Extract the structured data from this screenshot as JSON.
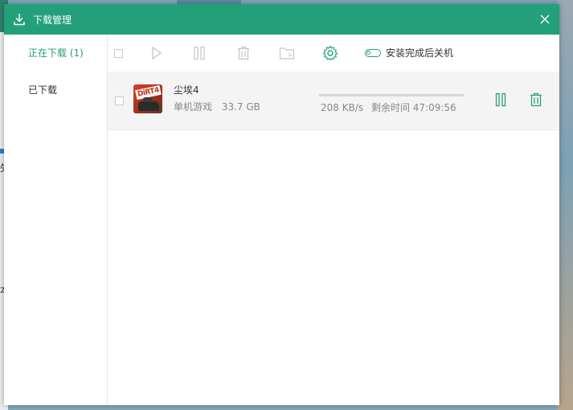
{
  "window": {
    "title": "下载管理"
  },
  "sidebar": {
    "items": [
      {
        "label": "正在下载 (1)",
        "active": true
      },
      {
        "label": "已下载",
        "active": false
      }
    ]
  },
  "toolbar": {
    "select_all": false,
    "shutdown_toggle": {
      "label": "安装完成后关机",
      "on": false
    }
  },
  "downloads": [
    {
      "name": "尘埃4",
      "category": "单机游戏",
      "size": "33.7 GB",
      "speed": "208 KB/s",
      "remaining": "剩余时间 47:09:56",
      "progress": 0.0,
      "checked": false
    }
  ],
  "background": {
    "left_chars": [
      "失",
      "本"
    ]
  },
  "colors": {
    "accent": "#23a07a",
    "icon_gray": "#c4c4c4"
  }
}
